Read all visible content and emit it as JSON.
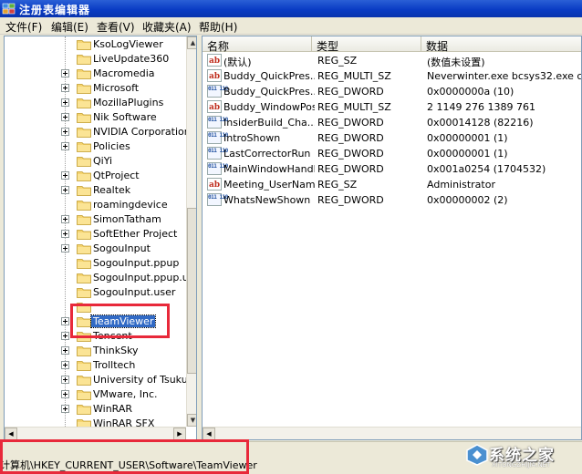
{
  "window": {
    "title": "注册表编辑器"
  },
  "menu": [
    "文件(F)",
    "编辑(E)",
    "查看(V)",
    "收藏夹(A)",
    "帮助(H)"
  ],
  "tree": {
    "items": [
      {
        "label": "KsoLogViewer",
        "expandable": false
      },
      {
        "label": "LiveUpdate360",
        "expandable": false
      },
      {
        "label": "Macromedia",
        "expandable": true
      },
      {
        "label": "Microsoft",
        "expandable": true
      },
      {
        "label": "MozillaPlugins",
        "expandable": true
      },
      {
        "label": "Nik Software",
        "expandable": true
      },
      {
        "label": "NVIDIA Corporation",
        "expandable": true
      },
      {
        "label": "Policies",
        "expandable": true
      },
      {
        "label": "QiYi",
        "expandable": false
      },
      {
        "label": "QtProject",
        "expandable": true
      },
      {
        "label": "Realtek",
        "expandable": true
      },
      {
        "label": "roamingdevice",
        "expandable": false
      },
      {
        "label": "SimonTatham",
        "expandable": true
      },
      {
        "label": "SoftEther Project",
        "expandable": true
      },
      {
        "label": "SogouInput",
        "expandable": true
      },
      {
        "label": "SogouInput.ppup",
        "expandable": false
      },
      {
        "label": "SogouInput.ppup.us",
        "expandable": false
      },
      {
        "label": "SogouInput.user",
        "expandable": false
      },
      {
        "label": "",
        "expandable": false
      },
      {
        "label": "TeamViewer",
        "expandable": true,
        "selected": true
      },
      {
        "label": "Tencent",
        "expandable": true
      },
      {
        "label": "ThinkSky",
        "expandable": true
      },
      {
        "label": "Trolltech",
        "expandable": true
      },
      {
        "label": "University of Tsukub",
        "expandable": true
      },
      {
        "label": "VMware, Inc.",
        "expandable": true
      },
      {
        "label": "WinRAR",
        "expandable": true
      },
      {
        "label": "WinRAR SFX",
        "expandable": false
      },
      {
        "label": "Wow6432Node",
        "expandable": true
      }
    ]
  },
  "list": {
    "columns": [
      "名称",
      "类型",
      "数据"
    ],
    "rows": [
      {
        "icon": "sz",
        "name": "(默认)",
        "type": "REG_SZ",
        "data": "(数值未设置)"
      },
      {
        "icon": "sz",
        "name": "Buddy_QuickPres...",
        "type": "REG_MULTI_SZ",
        "data": "Neverwinter.exe bcsys32.exe cadv"
      },
      {
        "icon": "bin",
        "name": "Buddy_QuickPres...",
        "type": "REG_DWORD",
        "data": "0x0000000a (10)"
      },
      {
        "icon": "sz",
        "name": "Buddy_WindowPos",
        "type": "REG_MULTI_SZ",
        "data": "2 1149 276 1389 761"
      },
      {
        "icon": "bin",
        "name": "InsiderBuild_Cha...",
        "type": "REG_DWORD",
        "data": "0x00014128 (82216)"
      },
      {
        "icon": "bin",
        "name": "IntroShown",
        "type": "REG_DWORD",
        "data": "0x00000001 (1)"
      },
      {
        "icon": "bin",
        "name": "LastCorrectorRun",
        "type": "REG_DWORD",
        "data": "0x00000001 (1)"
      },
      {
        "icon": "bin",
        "name": "MainWindowHandle",
        "type": "REG_DWORD",
        "data": "0x001a0254 (1704532)"
      },
      {
        "icon": "sz",
        "name": "Meeting_UserName",
        "type": "REG_SZ",
        "data": "Administrator"
      },
      {
        "icon": "bin",
        "name": "WhatsNewShown",
        "type": "REG_DWORD",
        "data": "0x00000002 (2)"
      }
    ]
  },
  "status": {
    "path": "计算机\\HKEY_CURRENT_USER\\Software\\TeamViewer"
  },
  "icons": {
    "sz": "ab",
    "bin": "011 110"
  },
  "watermark": {
    "text": "系统之家",
    "sub": "XITONGZHIJIA.NET"
  },
  "colors": {
    "highlight": "#e8293a",
    "selection": "#316ac5",
    "titlebar": "#0a3cc4"
  }
}
